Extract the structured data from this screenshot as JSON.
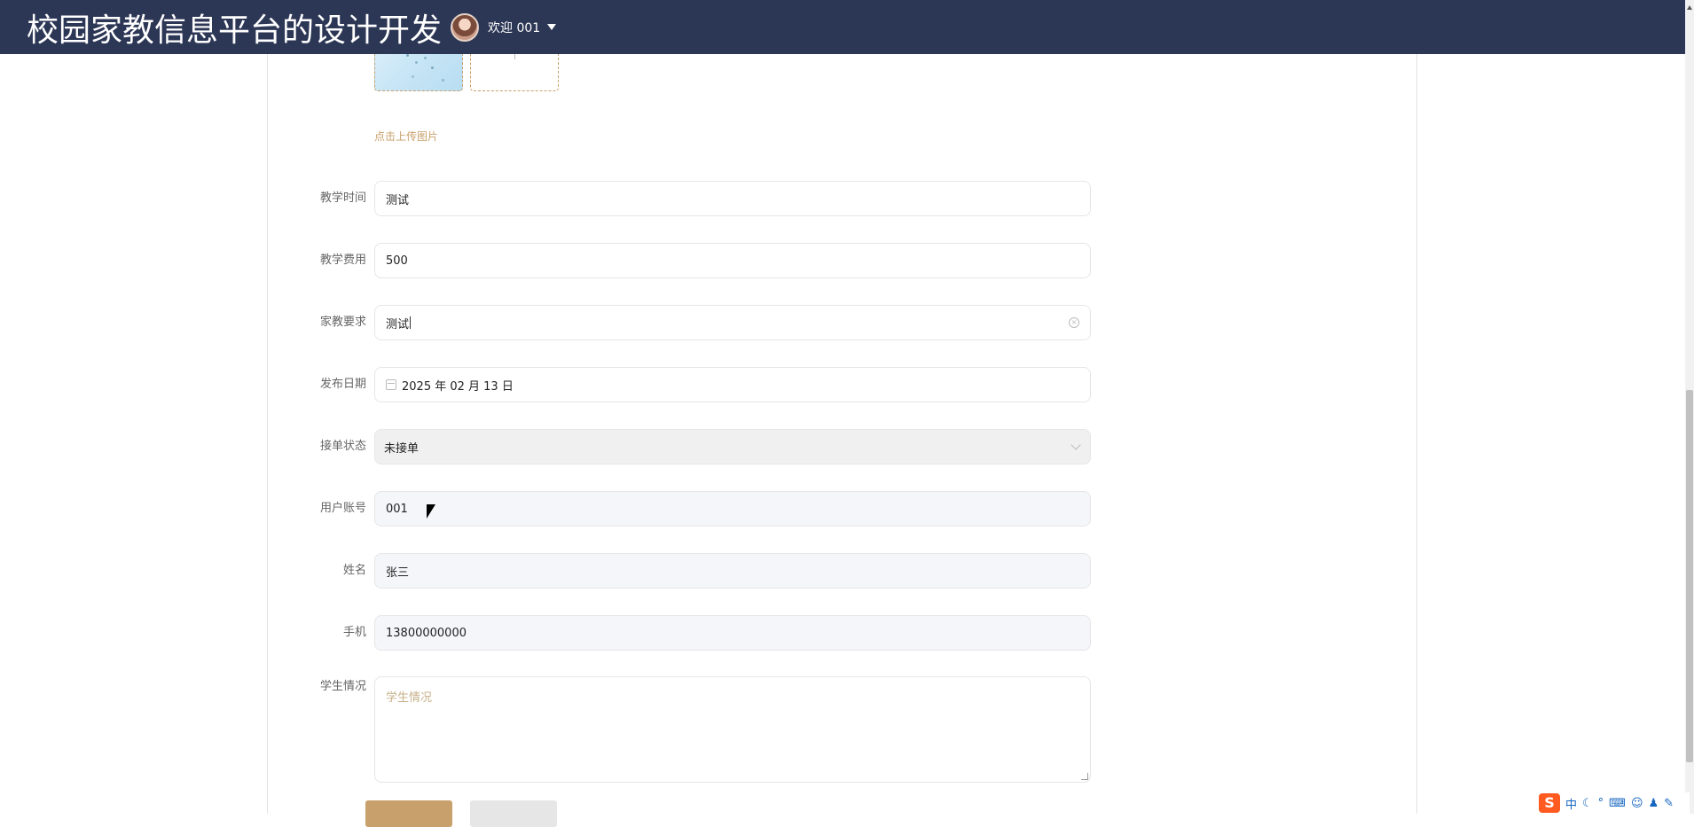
{
  "header": {
    "app_title": "校园家教信息平台的设计开发",
    "welcome_text": "欢迎 001"
  },
  "uploader": {
    "hint": "点击上传图片"
  },
  "form": {
    "teaching_time": {
      "label": "教学时间",
      "value": "测试"
    },
    "teaching_fee": {
      "label": "教学费用",
      "value": "500"
    },
    "tutor_requirements": {
      "label": "家教要求",
      "value": "测试"
    },
    "publish_date": {
      "label": "发布日期",
      "value": "2025 年 02 月 13 日"
    },
    "order_status": {
      "label": "接单状态",
      "value": "未接单"
    },
    "user_account": {
      "label": "用户账号",
      "value": "001"
    },
    "name": {
      "label": "姓名",
      "value": "张三"
    },
    "phone": {
      "label": "手机",
      "value": "13800000000"
    },
    "student_info": {
      "label": "学生情况",
      "placeholder": "学生情况"
    }
  },
  "ime": {
    "logo": "S",
    "mode": "中"
  },
  "colors": {
    "header_bg": "#2c3655",
    "accent": "#c8a06b"
  }
}
